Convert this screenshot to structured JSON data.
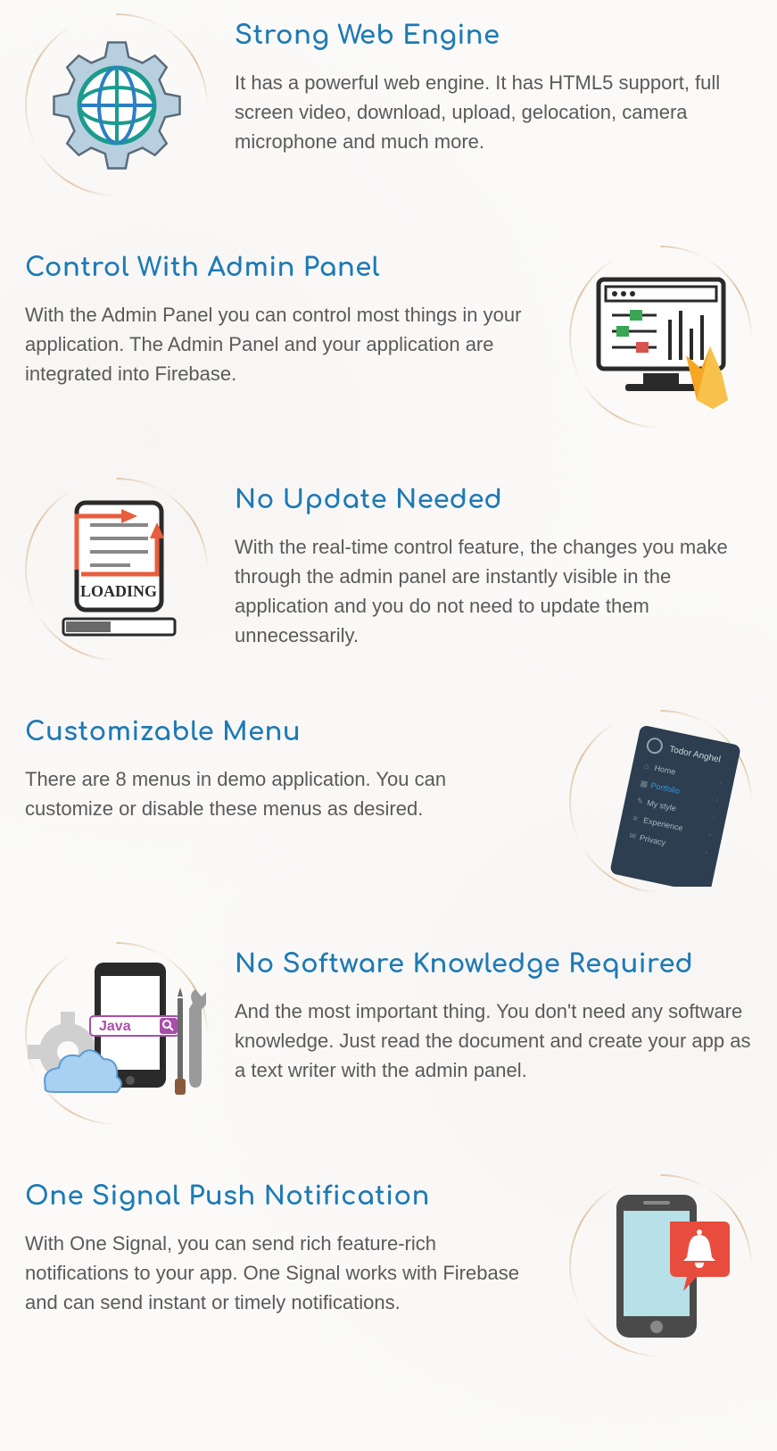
{
  "features": [
    {
      "title": "Strong Web Engine",
      "body": "It has a powerful web engine. It has HTML5 support, full screen video, download, upload, gelocation, camera microphone and much more."
    },
    {
      "title": "Control With Admin Panel",
      "body": "With the Admin Panel you can control most things in your application. The Admin Panel and your application are integrated into Firebase."
    },
    {
      "title": "No Update Needed",
      "body": "With the real-time control feature, the changes you make through the admin panel are instantly visible in the application and you do not need to update them unnecessarily."
    },
    {
      "title": "Customizable Menu",
      "body": "There are 8 menus in demo application. You can customize or disable these menus as desired."
    },
    {
      "title": "No Software Knowledge Required",
      "body": "And the most important thing. You don't need any software knowledge. Just read the document and create your app as a text writer with the admin panel."
    },
    {
      "title": "One Signal Push Notification",
      "body": "With One Signal, you can send rich feature-rich notifications to your app. One Signal works with Firebase and can send instant or timely notifications."
    }
  ]
}
